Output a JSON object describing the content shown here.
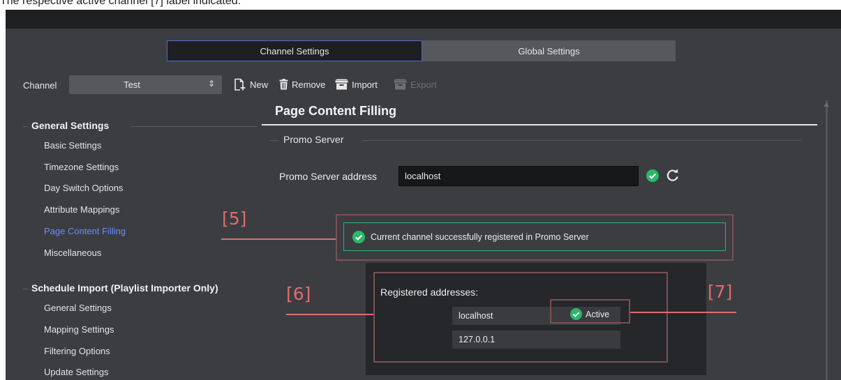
{
  "caption": "The respective active channel [7] label indicated.",
  "tabs": [
    {
      "label": "Channel Settings",
      "active": true
    },
    {
      "label": "Global Settings",
      "active": false
    }
  ],
  "toolbar": {
    "channel_label": "Channel",
    "channel_value": "Test",
    "new_label": "New",
    "remove_label": "Remove",
    "import_label": "Import",
    "export_label": "Export"
  },
  "sidebar": {
    "groups": [
      {
        "title": "General Settings",
        "items": [
          "Basic Settings",
          "Timezone Settings",
          "Day Switch Options",
          "Attribute Mappings",
          "Page Content Filling",
          "Miscellaneous"
        ]
      },
      {
        "title": "Schedule Import (Playlist Importer Only)",
        "items": [
          "General Settings",
          "Mapping Settings",
          "Filtering Options",
          "Update Settings"
        ]
      }
    ],
    "active_item": "Page Content Filling"
  },
  "main": {
    "page_title": "Page Content Filling",
    "section_title": "Promo Server",
    "address_label": "Promo Server address",
    "address_value": "localhost",
    "status_message": "Current channel successfully registered in Promo Server",
    "registered_title": "Registered addresses:",
    "registered_addresses": [
      "localhost",
      "127.0.0.1"
    ],
    "active_label": "Active"
  },
  "annotations": [
    "[5]",
    "[6]",
    "[7]"
  ],
  "colors": {
    "background": "#3b3d41",
    "accent_blue": "#6f8cf5",
    "tab_border": "#4b6bd6",
    "success_green": "#2ab86b",
    "annotation_red": "#e06c6c"
  }
}
